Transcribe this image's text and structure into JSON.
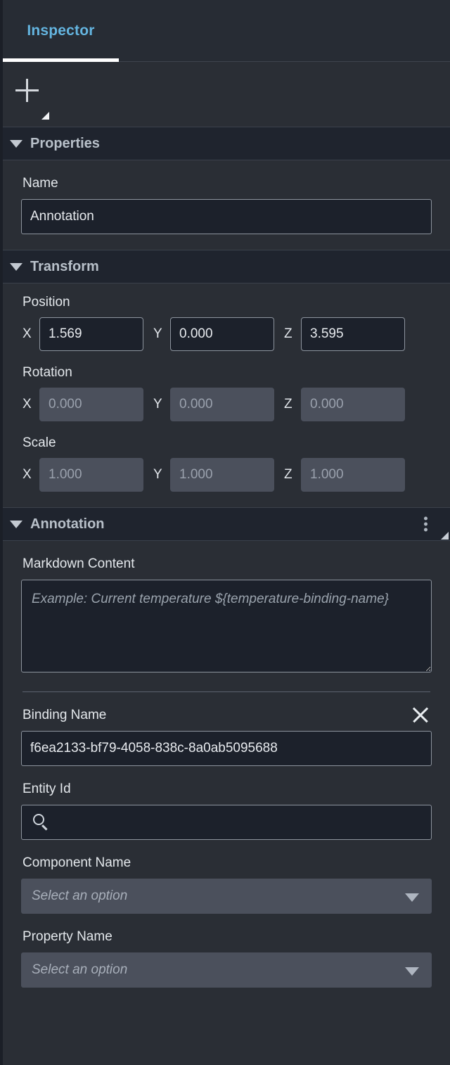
{
  "tabs": [
    {
      "label": "Inspector",
      "active": true
    }
  ],
  "toolbar": {
    "add_icon": "plus-icon",
    "resize_handle_icon": "resize-triangle-icon"
  },
  "sections": {
    "properties": {
      "title": "Properties",
      "collapse_icon": "caret-down-icon",
      "name_label": "Name",
      "name_value": "Annotation"
    },
    "transform": {
      "title": "Transform",
      "collapse_icon": "caret-down-icon",
      "position": {
        "label": "Position",
        "axes": [
          "X",
          "Y",
          "Z"
        ],
        "values": [
          "1.569",
          "0.000",
          "3.595"
        ],
        "enabled": true
      },
      "rotation": {
        "label": "Rotation",
        "axes": [
          "X",
          "Y",
          "Z"
        ],
        "values": [
          "0.000",
          "0.000",
          "0.000"
        ],
        "enabled": false
      },
      "scale": {
        "label": "Scale",
        "axes": [
          "X",
          "Y",
          "Z"
        ],
        "values": [
          "1.000",
          "1.000",
          "1.000"
        ],
        "enabled": false
      }
    },
    "annotation": {
      "title": "Annotation",
      "collapse_icon": "caret-down-icon",
      "menu_icon": "kebab-menu-icon",
      "resize_icon": "resize-triangle-icon",
      "markdown_label": "Markdown Content",
      "markdown_value": "",
      "markdown_placeholder": "Example: Current temperature ${temperature-binding-name}",
      "binding_name_label": "Binding Name",
      "binding_name_value": "f6ea2133-bf79-4058-838c-8a0ab5095688",
      "binding_clear_icon": "close-icon",
      "entity_id_label": "Entity Id",
      "entity_id_value": "",
      "entity_id_placeholder": "",
      "entity_search_icon": "search-icon",
      "component_name_label": "Component Name",
      "component_name_placeholder": "Select an option",
      "property_name_label": "Property Name",
      "property_name_placeholder": "Select an option",
      "dropdown_icon": "chevron-down-icon"
    }
  },
  "colors": {
    "accent_tab": "#64b5e0",
    "panel_bg": "#2a2e35",
    "section_header_bg": "#1f242e",
    "input_bg": "#1c212b",
    "disabled_bg": "#4b505c"
  }
}
